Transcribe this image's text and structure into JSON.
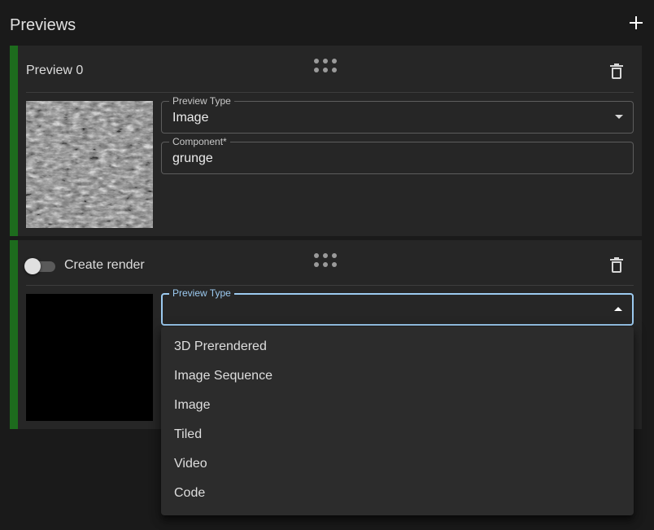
{
  "header": {
    "title": "Previews"
  },
  "cards": [
    {
      "title": "Preview 0",
      "fields": [
        {
          "label": "Preview Type",
          "value": "Image"
        },
        {
          "label": "Component*",
          "value": "grunge"
        }
      ]
    },
    {
      "toggle_label": "Create render",
      "toggle_on": false,
      "fields": [
        {
          "label": "Preview Type",
          "value": ""
        }
      ]
    }
  ],
  "dropdown": {
    "options": [
      "3D Prerendered",
      "Image Sequence",
      "Image",
      "Tiled",
      "Video",
      "Code"
    ]
  },
  "colors": {
    "accent": "#1d6b1d",
    "focus": "#9ccaf0",
    "background": "#1a1a1a",
    "card": "#262626"
  },
  "icons": {
    "add": "plus-icon",
    "drag": "drag-handle-icon",
    "delete": "trash-icon",
    "select": "chevron-down-icon"
  }
}
